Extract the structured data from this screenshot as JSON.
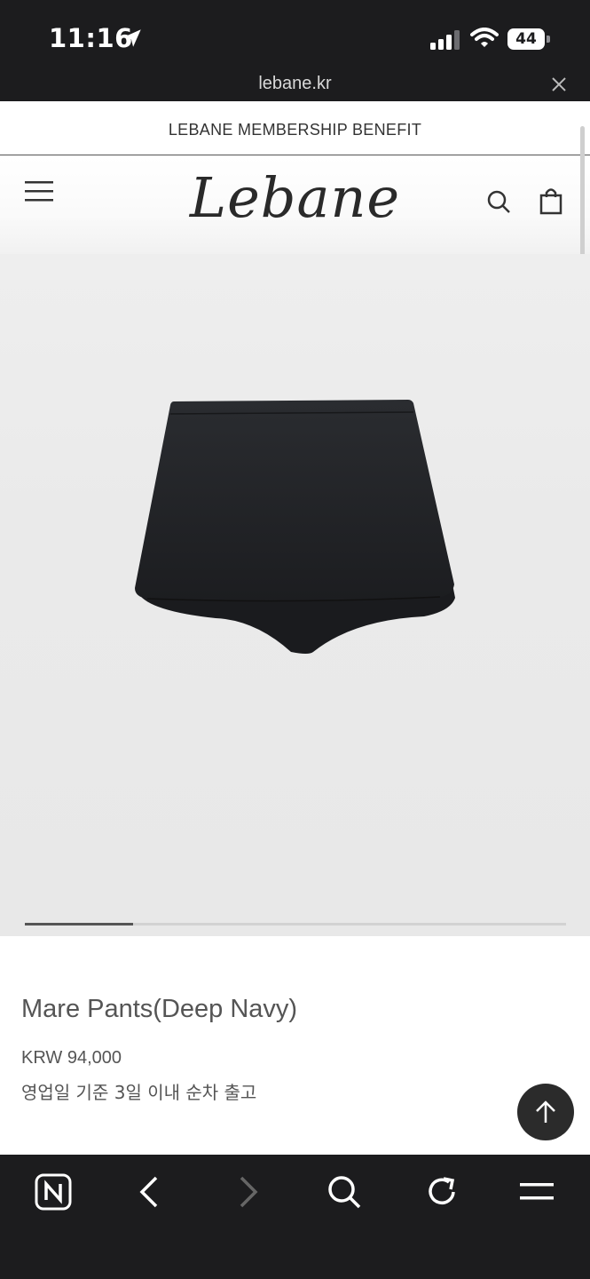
{
  "status_bar": {
    "time": "11:16",
    "battery": "44"
  },
  "browser": {
    "url": "lebane.kr"
  },
  "announcement": {
    "text": "LEBANE MEMBERSHIP BENEFIT"
  },
  "header": {
    "logo": "Lebane"
  },
  "hero": {
    "image_progress_fraction": 0.2
  },
  "product": {
    "name": "Mare Pants(Deep Navy)",
    "price": "KRW 94,000",
    "shipping_note": "영업일 기준 3일 이내 순차 출고"
  },
  "icons": {
    "status": [
      "location-arrow-icon",
      "signal-icon",
      "wifi-icon",
      "battery-icon"
    ],
    "header": [
      "menu-icon",
      "search-icon",
      "shopping-bag-icon"
    ],
    "bottom_nav": [
      "naver-home-icon",
      "back-icon",
      "forward-icon",
      "search-icon",
      "refresh-icon",
      "menu-icon"
    ]
  },
  "colors": {
    "dark_bar": "#1c1c1e",
    "text": "#555555",
    "hero_bg": "#eaeaea"
  }
}
